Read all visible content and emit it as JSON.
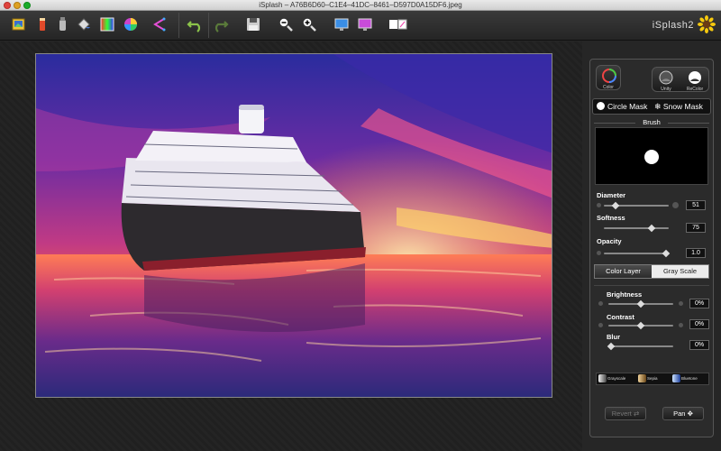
{
  "window": {
    "title": "iSplash – A76B6D60–C1E4–41DC–8461–D597D0A15DF6.jpeg"
  },
  "toolbar": {
    "brand": "iSplash2",
    "buttons": [
      {
        "name": "open-image-icon"
      },
      {
        "name": "paint-bucket-icon"
      },
      {
        "name": "paint-tube-icon"
      },
      {
        "name": "fill-icon"
      },
      {
        "name": "color-grid-icon"
      },
      {
        "name": "color-wheel-icon"
      },
      {
        "name": "share-icon"
      },
      {
        "name": "undo-icon"
      },
      {
        "name": "redo-icon"
      },
      {
        "name": "save-icon"
      },
      {
        "name": "zoom-out-icon"
      },
      {
        "name": "zoom-in-icon"
      },
      {
        "name": "display-icon"
      },
      {
        "name": "fullscreen-icon"
      },
      {
        "name": "compare-icon"
      }
    ]
  },
  "panel": {
    "color_label": "Color",
    "unity_label": "Unity",
    "recolor_label": "ReColor",
    "masks": {
      "circle": "Circle Mask",
      "snow": "Snow Mask"
    },
    "brush_title": "Brush",
    "diameter": {
      "label": "Diameter",
      "value": "51",
      "level": 0.15
    },
    "softness": {
      "label": "Softness",
      "value": "75",
      "level": 0.75
    },
    "opacity": {
      "label": "Opacity",
      "value": "1.0",
      "level": 1.0
    },
    "tabs": {
      "color_layer": "Color Layer",
      "gray_scale": "Gray Scale"
    },
    "brightness": {
      "label": "Brightness",
      "value": "0%",
      "level": 0.5
    },
    "contrast": {
      "label": "Contrast",
      "value": "0%",
      "level": 0.5
    },
    "blur": {
      "label": "Blur",
      "value": "0%",
      "level": 0.0
    },
    "presets": {
      "grayscale": "Grayscale",
      "sepia": "Sepia",
      "bluetone": "Bluetone"
    },
    "revert_label": "Revert",
    "pan_label": "Pan"
  },
  "colors": {
    "panel_bg": "#2b2b2b",
    "toolbar_bg": "#2d2d2d",
    "sky_top": "#2a2c9e",
    "sky_mid": "#c13a84",
    "sunset": "#ffb13d"
  }
}
